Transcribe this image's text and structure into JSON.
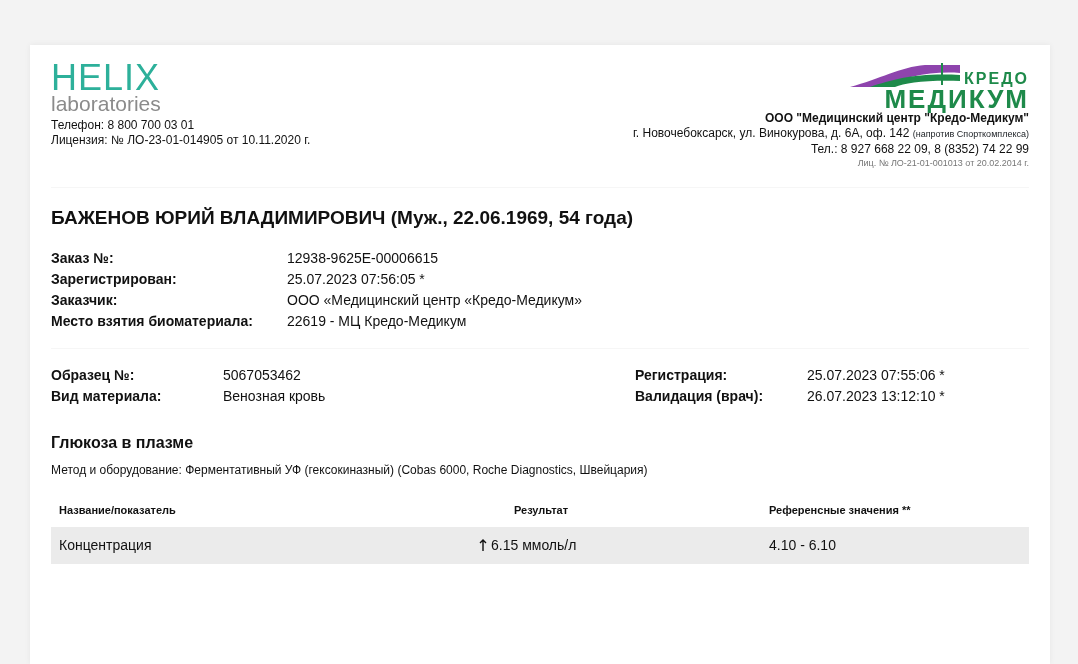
{
  "lab": {
    "logo_main": "HELIX",
    "logo_sub": "laboratories",
    "phone": "Телефон: 8 800 700 03 01",
    "license": "Лицензия: № ЛО-23-01-014905 от 10.11.2020 г."
  },
  "clinic": {
    "logo_top": "КРЕДО",
    "logo_main": "МЕДИКУМ",
    "name": "ООО \"Медицинский центр \"Кредо-Медикум\"",
    "address": "г. Новочебоксарск, ул. Винокурова, д. 6А, оф. 142",
    "address_note": "(напротив Спорткомплекса)",
    "phone": "Тел.: 8 927 668 22 09, 8 (8352) 74 22 99",
    "license": "Лиц. № ЛО-21-01-001013 от 20.02.2014 г."
  },
  "patient": "БАЖЕНОВ ЮРИЙ ВЛАДИМИРОВИЧ (Муж., 22.06.1969, 54 года)",
  "order": [
    {
      "label": "Заказ №:",
      "value": "12938-9625E-00006615"
    },
    {
      "label": "Зарегистрирован:",
      "value": "25.07.2023 07:56:05 *"
    },
    {
      "label": "Заказчик:",
      "value": "ООО «Медицинский центр «Кредо-Медикум»"
    },
    {
      "label": "Место взятия биоматериала:",
      "value": "22619 - МЦ Кредо-Медикум"
    }
  ],
  "sample_left": [
    {
      "label": "Образец №:",
      "value": "5067053462"
    },
    {
      "label": "Вид материала:",
      "value": "Венозная кровь"
    }
  ],
  "sample_right": [
    {
      "label": "Регистрация:",
      "value": "25.07.2023 07:55:06 *"
    },
    {
      "label": "Валидация (врач):",
      "value": "26.07.2023 13:12:10 *"
    }
  ],
  "test": {
    "title": "Глюкоза в плазме",
    "method": "Метод и оборудование: Ферментативный УФ (гексокиназный) (Cobas 6000, Roche Diagnostics, Швейцария)",
    "columns": [
      "Название/показатель",
      "Результат",
      "Референсные значения **"
    ],
    "rows": [
      {
        "name": "Концентрация",
        "above_range": true,
        "result": "6.15 ммоль/л",
        "reference": "4.10 - 6.10"
      }
    ]
  }
}
